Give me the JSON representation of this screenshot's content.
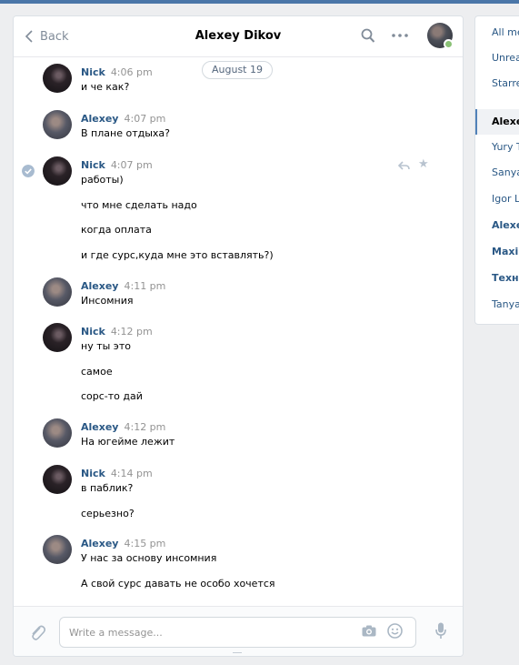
{
  "chat": {
    "back_label": "Back",
    "title": "Alexey Dikov",
    "date_divider": "August 19",
    "composer_placeholder": "Write a message...",
    "messages": [
      {
        "author": "Nick",
        "time": "4:06 pm",
        "lines": [
          "и че как?"
        ]
      },
      {
        "author": "Alexey",
        "time": "4:07 pm",
        "lines": [
          "В плане отдыха?"
        ]
      },
      {
        "author": "Nick",
        "time": "4:07 pm",
        "lines": [
          "работы)",
          "что мне сделать надо",
          "когда оплата",
          "и где сурс,куда мне это вставлять?)"
        ]
      },
      {
        "author": "Alexey",
        "time": "4:11 pm",
        "lines": [
          "Инсомния"
        ]
      },
      {
        "author": "Nick",
        "time": "4:12 pm",
        "lines": [
          "ну ты это",
          "самое",
          "сорс-то дай"
        ]
      },
      {
        "author": "Alexey",
        "time": "4:12 pm",
        "lines": [
          "На югейме лежит"
        ]
      },
      {
        "author": "Nick",
        "time": "4:14 pm",
        "lines": [
          "в паблик?",
          "серьезно?"
        ]
      },
      {
        "author": "Alexey",
        "time": "4:15 pm",
        "lines": [
          "У нас за основу инсомния",
          "А свой сурс давать не особо хочется"
        ]
      }
    ]
  },
  "sidebar": {
    "filters": [
      "All me",
      "Unrea",
      "Starre"
    ],
    "conversations": [
      "Alexe",
      "Yury T",
      "Sanya",
      "Igor L",
      "Alexe",
      "Maxir",
      "Техно",
      "Tanya"
    ]
  },
  "colors": {
    "accent": "#4a76a8",
    "author_link": "#2a5885",
    "online": "#8ac176"
  },
  "icons": [
    "chevron-left-icon",
    "search-icon",
    "more-icon",
    "paperclip-icon",
    "camera-icon",
    "smile-icon",
    "microphone-icon",
    "reply-icon",
    "star-icon",
    "check-icon"
  ]
}
